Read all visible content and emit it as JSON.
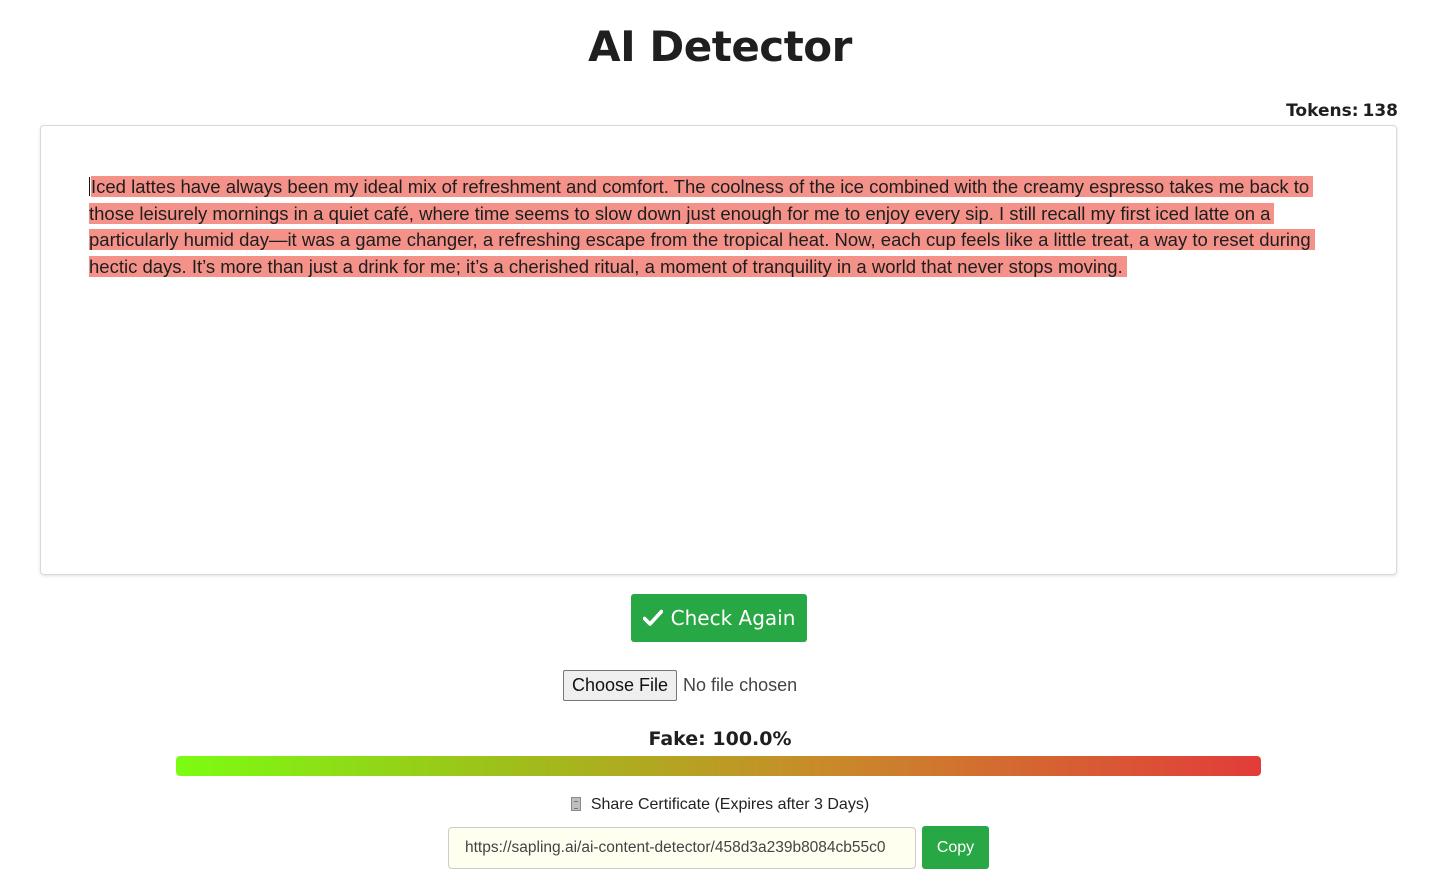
{
  "header": {
    "title": "AI Detector"
  },
  "tokens": {
    "label": "Tokens:",
    "count": "138"
  },
  "editor": {
    "text": "Iced lattes have always been my ideal mix of refreshment and comfort. The coolness of the ice combined with the creamy espresso takes me back to those leisurely mornings in a quiet café, where time seems to slow down just enough for me to enjoy every sip. I still recall my first iced latte on a particularly humid day—it was a game changer, a refreshing escape from the tropical heat. Now, each cup feels like a little treat, a way to reset during hectic days. It’s more than just a drink for me; it’s a cherished ritual, a moment of tranquility in a world that never stops moving.",
    "highlight_color": "#f4928a"
  },
  "actions": {
    "check_again_label": "Check Again",
    "check_icon": "check-icon",
    "button_color": "#28a745"
  },
  "file_input": {
    "button_label": "Choose File",
    "status": "No file chosen"
  },
  "result": {
    "label": "Fake: 100.0%",
    "fake_fraction": 1.0,
    "gradient_colors": [
      "#7cfc12",
      "#e23c3a"
    ]
  },
  "share": {
    "icon": "document-icon",
    "label": "Share Certificate (Expires after 3 Days)",
    "url": "https://sapling.ai/ai-content-detector/458d3a239b8084cb55c0",
    "copy_label": "Copy"
  }
}
